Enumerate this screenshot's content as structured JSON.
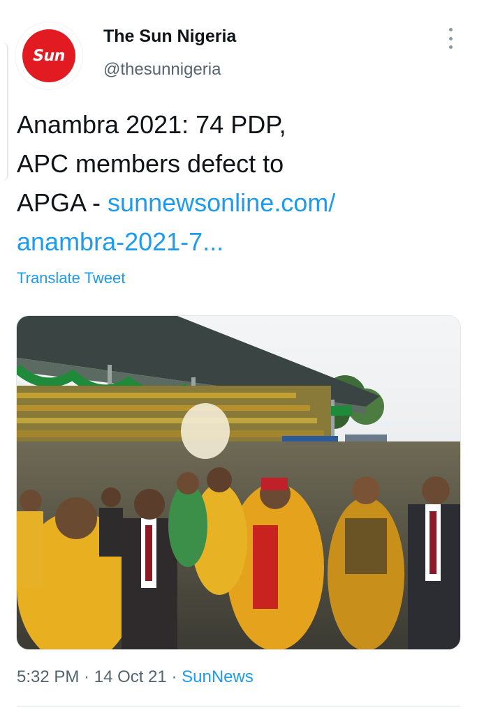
{
  "account": {
    "avatar_text": "Sun",
    "display_name": "The Sun Nigeria",
    "handle": "@thesunnigeria"
  },
  "tweet": {
    "text_line1": "Anambra 2021: 74 PDP,",
    "text_line2": "APC members defect to",
    "text_line3_prefix": "APGA - ",
    "link_line1": "sunnewsonline.com/",
    "link_line2": "anambra-2021-7...",
    "translate_label": "Translate Tweet"
  },
  "meta": {
    "time": "5:32 PM",
    "separator1": " · ",
    "date": "14 Oct 21",
    "separator2": " · ",
    "source": "SunNews"
  },
  "colors": {
    "link": "#1d9bf0",
    "muted": "#536471",
    "brand_red": "#e21b23"
  },
  "icons": {
    "more": "more-vertical-icon"
  }
}
